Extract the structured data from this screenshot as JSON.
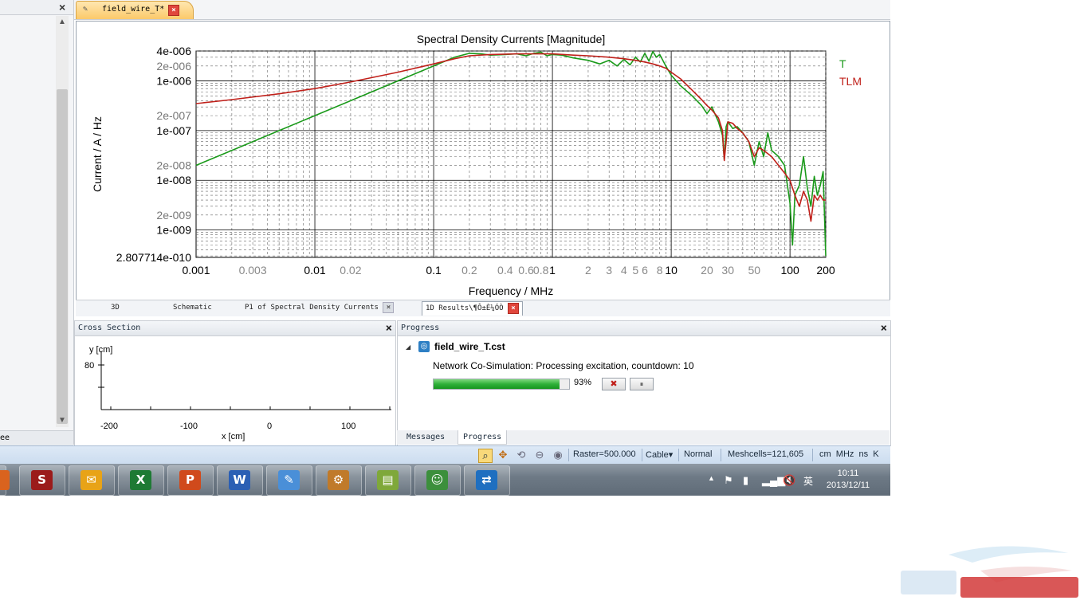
{
  "left_panel": {
    "close_label": "×",
    "bottom_label": "ee",
    "scroll_up": "▲",
    "scroll_down": "▼"
  },
  "editor": {
    "tab_label": "field_wire_T*",
    "tab_close": "×"
  },
  "chart_data": {
    "type": "line",
    "title": "Spectral Density Currents [Magnitude]",
    "xlabel": "Frequency / MHz",
    "ylabel": "Current / A / Hz",
    "x_scale": "log",
    "y_scale": "log",
    "xlim": [
      0.001,
      200
    ],
    "ylim": [
      2.807714e-10,
      4e-06
    ],
    "grid": true,
    "legend_position": "top-right",
    "x_ticks_major": [
      {
        "value": 0.001,
        "label": "0.001"
      },
      {
        "value": 0.01,
        "label": "0.01"
      },
      {
        "value": 0.1,
        "label": "0.1"
      },
      {
        "value": 1,
        "label": "1"
      },
      {
        "value": 10,
        "label": "10"
      },
      {
        "value": 100,
        "label": "100"
      },
      {
        "value": 200,
        "label": "200"
      }
    ],
    "x_ticks_minor": [
      {
        "value": 0.003,
        "label": "0.003"
      },
      {
        "value": 0.02,
        "label": "0.02"
      },
      {
        "value": 0.2,
        "label": "0.2"
      },
      {
        "value": 0.4,
        "label": "0.4"
      },
      {
        "value": 0.6,
        "label": "0.6"
      },
      {
        "value": 0.8,
        "label": "0.8"
      },
      {
        "value": 2,
        "label": "2"
      },
      {
        "value": 3,
        "label": "3"
      },
      {
        "value": 4,
        "label": "4"
      },
      {
        "value": 5,
        "label": "5"
      },
      {
        "value": 6,
        "label": "6"
      },
      {
        "value": 8,
        "label": "8"
      },
      {
        "value": 20,
        "label": "20"
      },
      {
        "value": 30,
        "label": "30"
      },
      {
        "value": 50,
        "label": "50"
      }
    ],
    "y_ticks_major": [
      {
        "value": 4e-06,
        "label": "4e-006"
      },
      {
        "value": 1e-06,
        "label": "1e-006"
      },
      {
        "value": 1e-07,
        "label": "1e-007"
      },
      {
        "value": 1e-08,
        "label": "1e-008"
      },
      {
        "value": 1e-09,
        "label": "1e-009"
      },
      {
        "value": 2.807714e-10,
        "label": "2.807714e-010"
      }
    ],
    "y_ticks_minor": [
      {
        "value": 2e-06,
        "label": "2e-006"
      },
      {
        "value": 2e-07,
        "label": "2e-007"
      },
      {
        "value": 2e-08,
        "label": "2e-008"
      },
      {
        "value": 2e-09,
        "label": "2e-009"
      }
    ],
    "series": [
      {
        "name": "T",
        "color": "#1a9a1a",
        "x": [
          0.001,
          0.002,
          0.005,
          0.01,
          0.02,
          0.05,
          0.1,
          0.15,
          0.2,
          0.25,
          0.3,
          0.4,
          0.5,
          0.6,
          0.7,
          0.8,
          0.9,
          1.0,
          1.2,
          1.5,
          2.0,
          2.5,
          3.0,
          3.5,
          4.0,
          4.5,
          5.0,
          5.5,
          6.0,
          6.5,
          7.0,
          7.5,
          8.0,
          9.0,
          10,
          12,
          15,
          18,
          20,
          22,
          25,
          27,
          28,
          29,
          30,
          33,
          36,
          40,
          45,
          50,
          55,
          60,
          65,
          70,
          80,
          90,
          100,
          105,
          110,
          120,
          130,
          140,
          150,
          160,
          170,
          180,
          190,
          200
        ],
        "y": [
          2e-08,
          4e-08,
          1e-07,
          2e-07,
          4e-07,
          1e-06,
          2e-06,
          3e-06,
          3.6e-06,
          3.5e-06,
          3.3e-06,
          3.4e-06,
          3.5e-06,
          3.2e-06,
          3.6e-06,
          3.8e-06,
          3.2e-06,
          3.4e-06,
          3.3e-06,
          2.9e-06,
          2.6e-06,
          2.2e-06,
          2.6e-06,
          2e-06,
          2.7e-06,
          2.1e-06,
          3e-06,
          2.4e-06,
          3.6e-06,
          2.5e-06,
          3.9e-06,
          3e-06,
          3.4e-06,
          2e-06,
          1.3e-06,
          8e-07,
          5e-07,
          3.2e-07,
          2.2e-07,
          3e-07,
          1.5e-07,
          8e-08,
          2.6e-08,
          1.2e-07,
          1.5e-07,
          1.1e-07,
          1.2e-07,
          9e-08,
          6e-08,
          2e-08,
          6e-08,
          3e-08,
          9e-08,
          4e-08,
          3e-08,
          2e-08,
          3.5e-09,
          5e-10,
          5e-09,
          8e-09,
          3e-08,
          7e-09,
          3e-09,
          1.2e-08,
          5e-09,
          8e-09,
          1.5e-08,
          3e-10
        ]
      },
      {
        "name": "TLM",
        "color": "#c0201a",
        "x": [
          0.001,
          0.002,
          0.005,
          0.01,
          0.02,
          0.05,
          0.1,
          0.15,
          0.2,
          0.3,
          0.5,
          0.7,
          1.0,
          1.5,
          2.0,
          3.0,
          4.0,
          5.0,
          6.0,
          7.0,
          8.0,
          9.0,
          10,
          12,
          15,
          18,
          20,
          22,
          25,
          27,
          28,
          29,
          30,
          33,
          36,
          40,
          45,
          50,
          55,
          60,
          70,
          80,
          90,
          100,
          110,
          120,
          130,
          140,
          150,
          160,
          170,
          180,
          190,
          200
        ],
        "y": [
          3.5e-07,
          4.2e-07,
          5.5e-07,
          7e-07,
          9.5e-07,
          1.5e-06,
          2.2e-06,
          2.8e-06,
          3.2e-06,
          3.4e-06,
          3.5e-06,
          3.5e-06,
          3.5e-06,
          3.3e-06,
          3.2e-06,
          3e-06,
          2.8e-06,
          2.6e-06,
          2.4e-06,
          2.2e-06,
          2e-06,
          1.8e-06,
          1.5e-06,
          1.1e-06,
          6.5e-07,
          4.2e-07,
          3.2e-07,
          2.6e-07,
          1.8e-07,
          1e-07,
          2.5e-08,
          6e-08,
          1.5e-07,
          1.4e-07,
          1.1e-07,
          9e-08,
          6e-08,
          3e-08,
          4.5e-08,
          4e-08,
          3e-08,
          2e-08,
          1.4e-08,
          1e-08,
          5e-09,
          3e-09,
          6e-09,
          4e-09,
          1.5e-09,
          5e-09,
          4e-09,
          5e-09,
          4e-09,
          4e-09
        ]
      }
    ]
  },
  "view_tabs": [
    {
      "label": "3D"
    },
    {
      "label": "Schematic"
    },
    {
      "label": "P1 of Spectral Density Currents"
    },
    {
      "label": "1D Results\\¶Ô±È¼ÓÒ"
    }
  ],
  "cross_section": {
    "title": "Cross Section",
    "close": "×",
    "y_label": "y [cm]",
    "x_label": "x [cm]",
    "y_tick": "80",
    "x_ticks": [
      "-200",
      "-100",
      "0",
      "100"
    ]
  },
  "progress": {
    "title": "Progress",
    "close": "×",
    "expander": "◢",
    "file": "field_wire_T.cst",
    "status": "Network Co-Simulation: Processing excitation, countdown: 10",
    "percent_label": "93%",
    "percent": 93,
    "cancel_symbol": "✖",
    "pause_symbol": "⏸",
    "tabs": [
      "Messages",
      "Progress"
    ]
  },
  "status_bar": {
    "raster": "Raster=500.000",
    "cable": "Cable▾",
    "mode": "Normal",
    "meshcells": "Meshcells=121,605",
    "units": "cm  MHz  ns  K"
  },
  "taskbar": {
    "apps": [
      {
        "name": "cst-app",
        "glyph": "S",
        "color": "#9b1b1b"
      },
      {
        "name": "outlook-app",
        "glyph": "✉",
        "color": "#e8a317"
      },
      {
        "name": "excel-app",
        "glyph": "X",
        "color": "#1e7a34"
      },
      {
        "name": "powerpoint-app",
        "glyph": "P",
        "color": "#d04a1c"
      },
      {
        "name": "word-app",
        "glyph": "W",
        "color": "#2b5fb4"
      },
      {
        "name": "paint-app",
        "glyph": "✎",
        "color": "#4a8fd8"
      },
      {
        "name": "tools-app",
        "glyph": "⚙",
        "color": "#c07a2a"
      },
      {
        "name": "viewer-app",
        "glyph": "▤",
        "color": "#7fa83a"
      },
      {
        "name": "messenger-app",
        "glyph": "☺",
        "color": "#3c8f3c"
      },
      {
        "name": "teamviewer-app",
        "glyph": "⇄",
        "color": "#1f6fc0"
      }
    ],
    "tray_arrow": "▲",
    "ime": "英",
    "time": "10:11",
    "date": "2013/12/11"
  }
}
